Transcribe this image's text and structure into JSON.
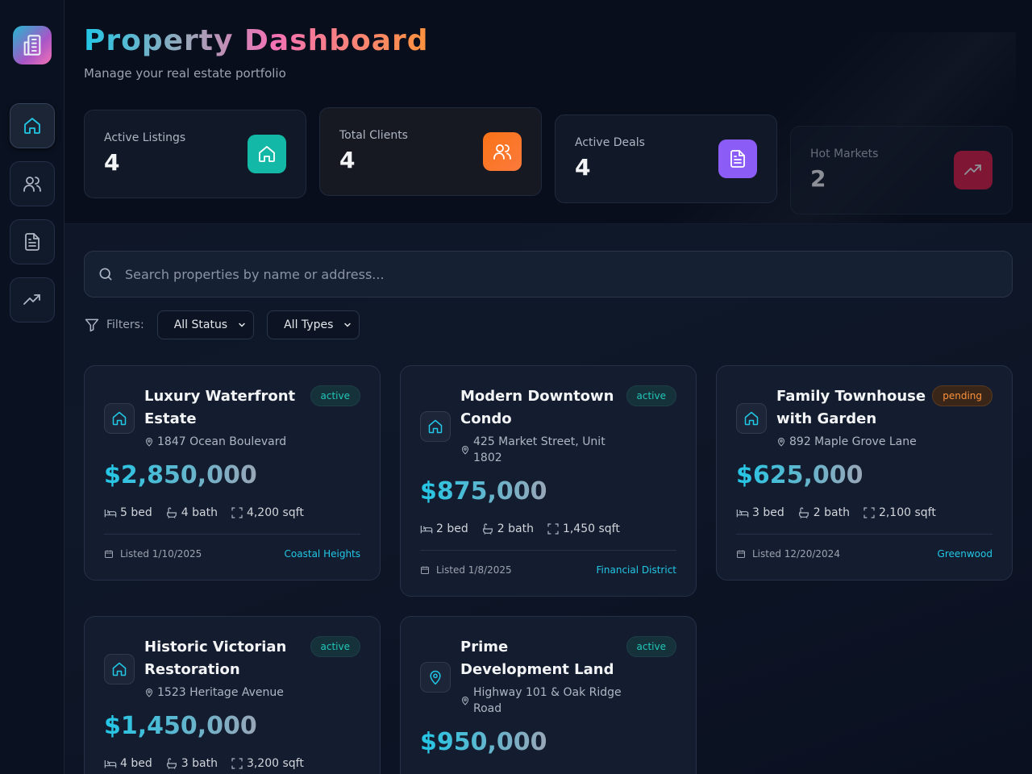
{
  "app": {
    "title": "Property Dashboard",
    "subtitle": "Manage your real estate portfolio"
  },
  "sidebar": {
    "items": [
      {
        "name": "home",
        "icon": "home-icon",
        "active": true
      },
      {
        "name": "clients",
        "icon": "users-icon",
        "active": false
      },
      {
        "name": "documents",
        "icon": "document-icon",
        "active": false
      },
      {
        "name": "analytics",
        "icon": "trending-up-icon",
        "active": false
      }
    ]
  },
  "stats": [
    {
      "label": "Active Listings",
      "value": "4",
      "icon": "home-icon",
      "color": "#14b8a6"
    },
    {
      "label": "Total Clients",
      "value": "4",
      "icon": "users-icon",
      "color": "#f97316"
    },
    {
      "label": "Active Deals",
      "value": "4",
      "icon": "document-icon",
      "color": "#8b5cf6"
    },
    {
      "label": "Hot Markets",
      "value": "2",
      "icon": "trending-up-icon",
      "color": "#e11d48"
    }
  ],
  "search": {
    "placeholder": "Search properties by name or address..."
  },
  "filters": {
    "label": "Filters:",
    "status": "All Status",
    "type": "All Types"
  },
  "properties": [
    {
      "title": "Luxury Waterfront Estate",
      "status": "active",
      "address": "1847 Ocean Boulevard",
      "price": "$2,850,000",
      "beds": "5 bed",
      "baths": "4 bath",
      "sqft": "4,200 sqft",
      "listed": "Listed 1/10/2025",
      "neighborhood": "Coastal Heights",
      "icon": "home-icon"
    },
    {
      "title": "Modern Downtown Condo",
      "status": "active",
      "address": "425 Market Street, Unit 1802",
      "price": "$875,000",
      "beds": "2 bed",
      "baths": "2 bath",
      "sqft": "1,450 sqft",
      "listed": "Listed 1/8/2025",
      "neighborhood": "Financial District",
      "icon": "home-icon"
    },
    {
      "title": "Family Townhouse with Garden",
      "status": "pending",
      "address": "892 Maple Grove Lane",
      "price": "$625,000",
      "beds": "3 bed",
      "baths": "2 bath",
      "sqft": "2,100 sqft",
      "listed": "Listed 12/20/2024",
      "neighborhood": "Greenwood",
      "icon": "home-icon"
    },
    {
      "title": "Historic Victorian Restoration",
      "status": "active",
      "address": "1523 Heritage Avenue",
      "price": "$1,450,000",
      "beds": "4 bed",
      "baths": "3 bath",
      "sqft": "3,200 sqft",
      "icon": "home-icon"
    },
    {
      "title": "Prime Development Land",
      "status": "active",
      "address": "Highway 101 & Oak Ridge Road",
      "price": "$950,000",
      "icon": "map-pin-icon"
    }
  ]
}
